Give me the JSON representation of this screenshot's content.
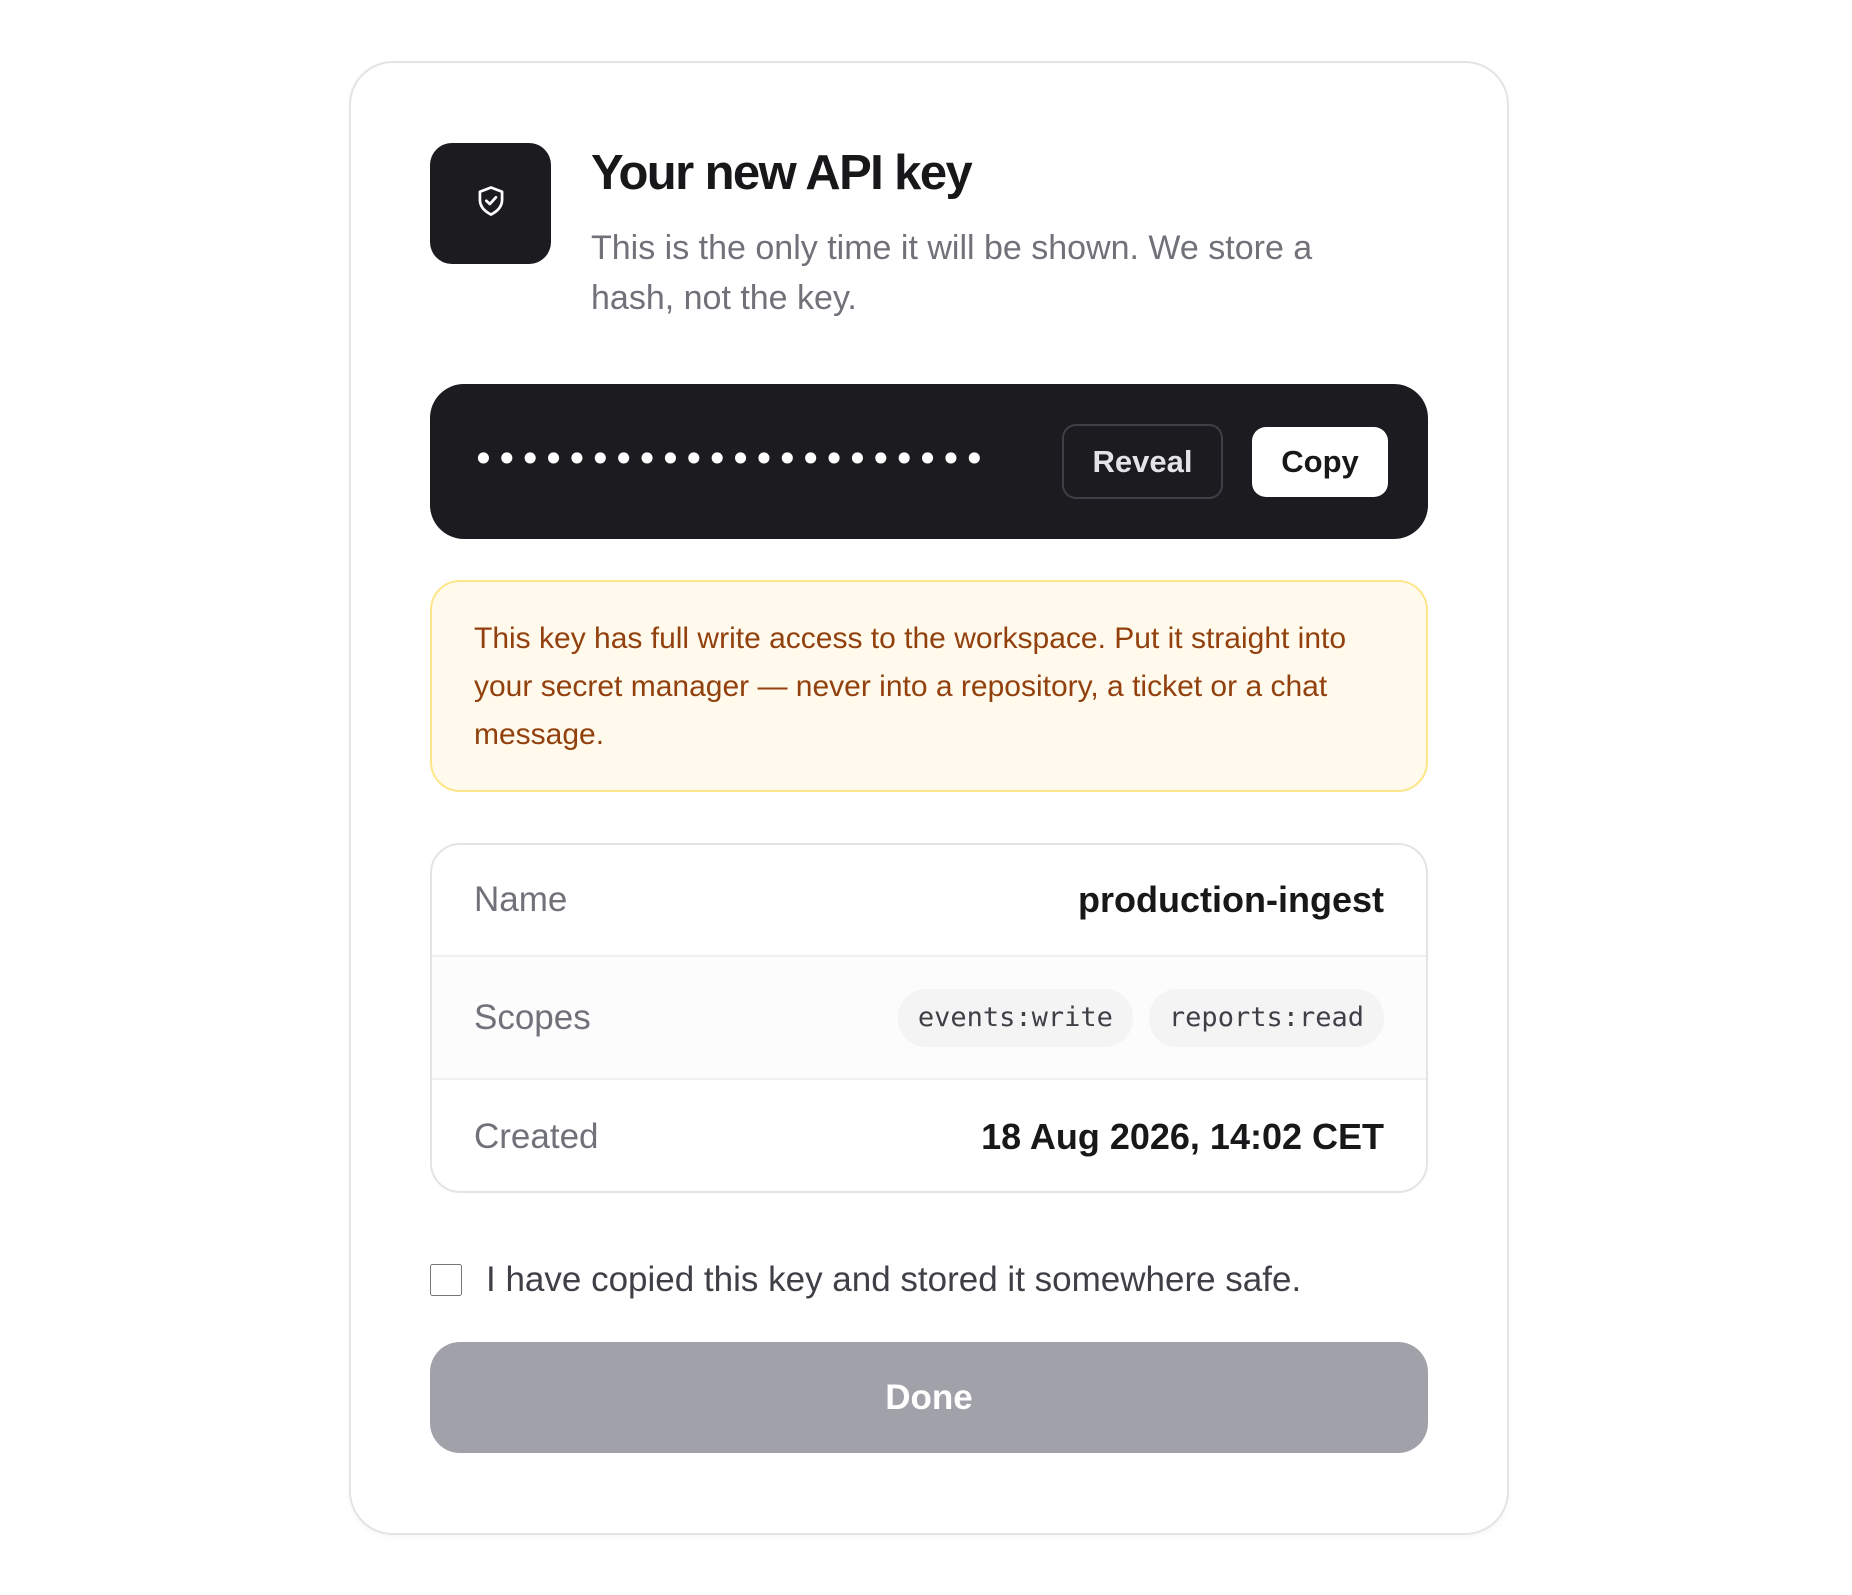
{
  "dialog": {
    "title": "Your new API key",
    "subtitle": "This is the only time it will be shown. We store a hash, not the key.",
    "icon": "shield-check-icon"
  },
  "key": {
    "masked_value": "••••••••••••••••••••••••••••••••••••••",
    "reveal_label": "Reveal",
    "copy_label": "Copy"
  },
  "warning": {
    "text": "This key has full write access to the workspace. Put it straight into your secret manager — never into a repository, a ticket or a chat message."
  },
  "details": {
    "name_label": "Name",
    "name_value": "production-ingest",
    "scopes_label": "Scopes",
    "scopes": [
      "events:write",
      "reports:read"
    ],
    "created_label": "Created",
    "created_value": "18 Aug 2026, 14:02 CET"
  },
  "confirm": {
    "label": "I have copied this key and stored it somewhere safe.",
    "checked": false
  },
  "done": {
    "label": "Done",
    "enabled": false
  },
  "colors": {
    "dark": "#1c1b1f",
    "warning_bg": "#fffaeb",
    "warning_border": "#fde68a",
    "warning_text": "#92400e",
    "done_disabled": "#a1a1aa"
  }
}
